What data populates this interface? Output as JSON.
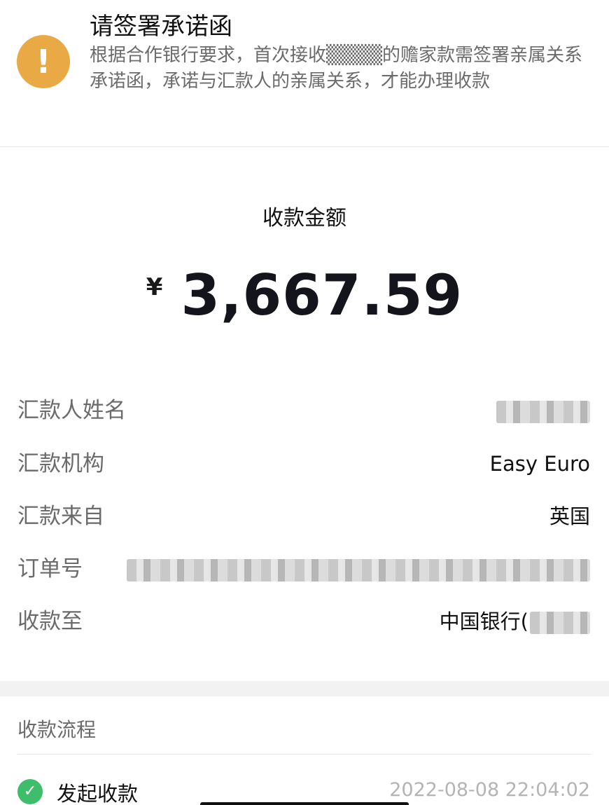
{
  "notice": {
    "icon": "exclamation-icon",
    "icon_glyph": "!",
    "icon_color": "#e9a944",
    "title": "请签署承诺函",
    "body": "根据合作银行要求，首次接收▒▒▒▒的赡家款需签署亲属关系承诺函，承诺与汇款人的亲属关系，才能办理收款"
  },
  "amount": {
    "label": "收款金额",
    "currency": "¥",
    "value": "3,667.59"
  },
  "details": {
    "remitter_name": {
      "label": "汇款人姓名",
      "value": ""
    },
    "institution": {
      "label": "汇款机构",
      "value": "Easy Euro"
    },
    "from": {
      "label": "汇款来自",
      "value": "英国"
    },
    "order_no": {
      "label": "订单号",
      "value": ""
    },
    "to": {
      "label": "收款至",
      "value": "中国银行("
    }
  },
  "flow": {
    "title": "收款流程",
    "steps": [
      {
        "icon": "check-circle-icon",
        "label": "发起收款",
        "time": "2022-08-08 22:04:02",
        "status_color": "#3ebd6a"
      }
    ]
  }
}
